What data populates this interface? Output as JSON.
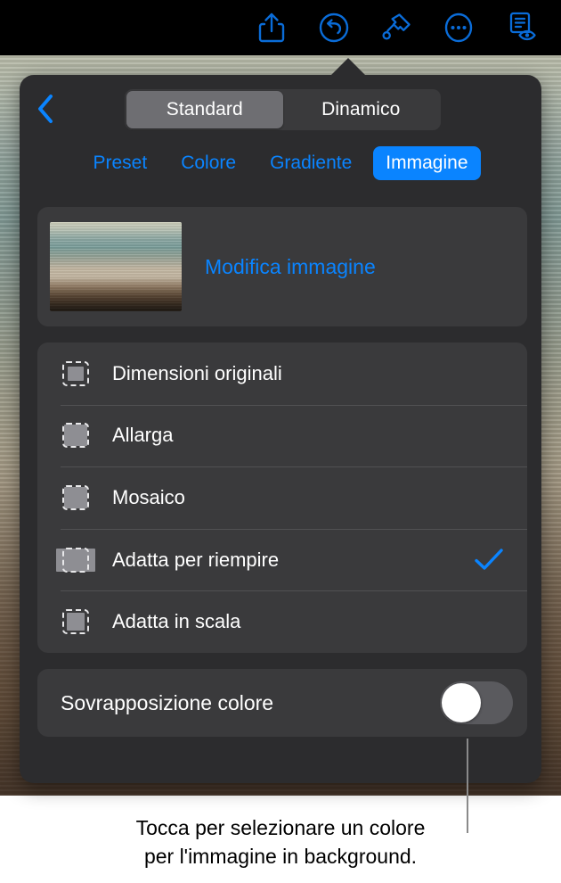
{
  "toolbar": {
    "buttons": [
      {
        "name": "share-icon",
        "label": "Condividi"
      },
      {
        "name": "undo-icon",
        "label": "Annulla"
      },
      {
        "name": "format-brush-icon",
        "label": "Formato"
      },
      {
        "name": "more-ellipsis-icon",
        "label": "Altro"
      },
      {
        "name": "document-preview-icon",
        "label": "Anteprima documento"
      }
    ]
  },
  "popover": {
    "back_button_label": "Indietro",
    "back_icon": "chevron-left-icon",
    "segmented": {
      "options": [
        "Standard",
        "Dinamico"
      ],
      "selected": "Standard"
    },
    "tabs": [
      {
        "label": "Preset",
        "active": false
      },
      {
        "label": "Colore",
        "active": false
      },
      {
        "label": "Gradiente",
        "active": false
      },
      {
        "label": "Immagine",
        "active": true
      }
    ],
    "image_card": {
      "thumbnail_name": "background-image-thumbnail",
      "edit_label": "Modifica immagine"
    },
    "options": [
      {
        "label": "Dimensioni originali",
        "icon": "original-size-icon",
        "selected": false
      },
      {
        "label": "Allarga",
        "icon": "stretch-icon",
        "selected": false
      },
      {
        "label": "Mosaico",
        "icon": "tile-icon",
        "selected": false
      },
      {
        "label": "Adatta per riempire",
        "icon": "scale-to-fill-icon",
        "selected": true
      },
      {
        "label": "Adatta in scala",
        "icon": "scale-to-fit-icon",
        "selected": false
      }
    ],
    "checkmark_icon": "checkmark-icon",
    "color_overlay": {
      "label": "Sovrapposizione colore",
      "toggle_state": "off"
    }
  },
  "caption": {
    "line1": "Tocca per selezionare un colore",
    "line2": "per l'immagine in background."
  },
  "colors": {
    "accent_blue": "#0a84ff",
    "popover_bg": "#2c2c2e",
    "card_bg": "#3a3a3c",
    "segmented_bg": "#3a3a3c",
    "segmented_selected": "#6e6e72",
    "toolbar_bg": "#000000",
    "text_primary": "#ffffff",
    "icon_grey": "#8e8e93",
    "callout_line": "#8a8a8a",
    "caption_text": "#000000"
  }
}
